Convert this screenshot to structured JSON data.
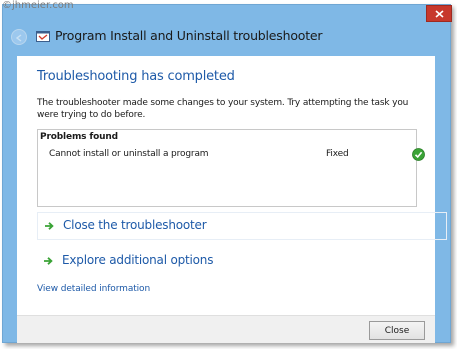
{
  "watermark": "©jhmeier.com",
  "window": {
    "title": "Program Install and Uninstall troubleshooter",
    "icons": {
      "back": "back-arrow-icon",
      "app": "app-icon",
      "close": "close-icon"
    }
  },
  "main": {
    "title": "Troubleshooting has completed",
    "description": "The troubleshooter made some changes to your system. Try attempting the task you were trying to do before."
  },
  "problems": {
    "header": "Problems found",
    "items": [
      {
        "name": "Cannot install or uninstall a program",
        "status": "Fixed",
        "status_icon": "green-check-icon"
      }
    ]
  },
  "actions": [
    {
      "label": "Close the troubleshooter",
      "icon": "green-arrow-icon"
    },
    {
      "label": "Explore additional options",
      "icon": "green-arrow-icon"
    }
  ],
  "links": {
    "details": "View detailed information"
  },
  "footer": {
    "close_label": "Close"
  },
  "colors": {
    "title_bar": "#7fb8e6",
    "link_blue": "#1e5aa8",
    "close_red": "#c7382c",
    "check_green": "#3aa336"
  }
}
